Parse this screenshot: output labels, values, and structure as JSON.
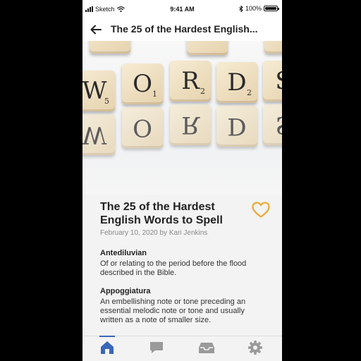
{
  "status_bar": {
    "carrier": "Sketch",
    "time": "9:41 AM",
    "battery": "100%",
    "battery_level": 1.0
  },
  "nav": {
    "title": "The 25 of the Hardest English..."
  },
  "hero": {
    "tiles": [
      {
        "letter": "W",
        "points": "5"
      },
      {
        "letter": "O",
        "points": "1"
      },
      {
        "letter": "R",
        "points": "2"
      },
      {
        "letter": "D",
        "points": "2"
      },
      {
        "letter": "S",
        "points": ""
      }
    ]
  },
  "article": {
    "title": "The 25 of the Hardest English Words to Spell",
    "meta": "February 10, 2020 by Kari Jenkins",
    "entries": [
      {
        "term": "Antediluvian",
        "definition": "Of or relating to the period before the flood described in the Bible."
      },
      {
        "term": "Appoggiatura",
        "definition": "An embellishing note or tone preceding an essential melodic note or tone and usually written as a note of smaller size."
      }
    ]
  },
  "tabs": [
    {
      "icon": "home-icon",
      "active": true
    },
    {
      "icon": "chat-icon",
      "active": false
    },
    {
      "icon": "inbox-icon",
      "active": false
    },
    {
      "icon": "gear-icon",
      "active": false
    }
  ],
  "colors": {
    "accent": "#3a66b8",
    "heart": "#f0a830",
    "inactive_icon": "#9a9a9a"
  }
}
